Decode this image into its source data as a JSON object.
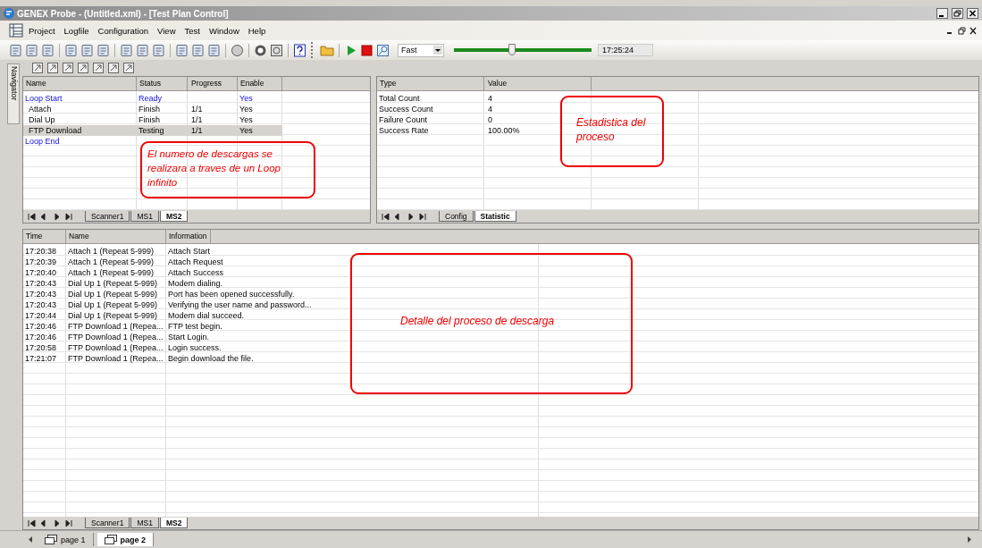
{
  "window": {
    "title": "GENEX Probe - (Untitled.xml) - [Test Plan Control]"
  },
  "menu": [
    "Project",
    "Logfile",
    "Configuration",
    "View",
    "Test",
    "Window",
    "Help"
  ],
  "toolbar": {
    "speed": "Fast",
    "level": 0.42,
    "clock": "17:25:24"
  },
  "navigator": {
    "label": "Navigator"
  },
  "test_plan": {
    "columns": [
      "Name",
      "Status",
      "Progress",
      "Enable"
    ],
    "rows": [
      {
        "kind": "loop",
        "selected": false,
        "cells": [
          "Loop Start",
          "Ready",
          "",
          "Yes"
        ]
      },
      {
        "kind": "step",
        "selected": false,
        "cells": [
          "Attach",
          "Finish",
          "1/1",
          "Yes"
        ]
      },
      {
        "kind": "step",
        "selected": false,
        "cells": [
          "Dial Up",
          "Finish",
          "1/1",
          "Yes"
        ]
      },
      {
        "kind": "step",
        "selected": true,
        "cells": [
          "FTP Download",
          "Testing",
          "1/1",
          "Yes"
        ]
      },
      {
        "kind": "loop",
        "selected": false,
        "cells": [
          "Loop End",
          "",
          "",
          ""
        ]
      }
    ],
    "tabs": [
      {
        "label": "Scanner1",
        "selected": false
      },
      {
        "label": "MS1",
        "selected": false
      },
      {
        "label": "MS2",
        "selected": true
      }
    ],
    "note": "El numero de descargas se realizara a traves de un Loop infinito"
  },
  "statistics": {
    "columns": [
      "Type",
      "Value"
    ],
    "rows": [
      [
        "Total Count",
        "4"
      ],
      [
        "Success Count",
        "4"
      ],
      [
        "Failure Count",
        "0"
      ],
      [
        "Success Rate",
        "100.00%"
      ]
    ],
    "tabs": [
      {
        "label": "Config",
        "selected": false
      },
      {
        "label": "Statistic",
        "selected": true
      }
    ],
    "note": "Estadistica del proceso"
  },
  "log": {
    "columns": [
      "Time",
      "Name",
      "Information"
    ],
    "rows": [
      [
        "17:20:38",
        "Attach 1 (Repeat 5-999)",
        "Attach Start"
      ],
      [
        "17:20:39",
        "Attach 1 (Repeat 5-999)",
        "Attach Request"
      ],
      [
        "17:20:40",
        "Attach 1 (Repeat 5-999)",
        "Attach Success"
      ],
      [
        "17:20:43",
        "Dial Up 1 (Repeat 5-999)",
        "Modem dialing."
      ],
      [
        "17:20:43",
        "Dial Up 1 (Repeat 5-999)",
        "Port has been opened successfully."
      ],
      [
        "17:20:43",
        "Dial Up 1 (Repeat 5-999)",
        "Verifying the user name and password..."
      ],
      [
        "17:20:44",
        "Dial Up 1 (Repeat 5-999)",
        "Modem dial succeed."
      ],
      [
        "17:20:46",
        "FTP Download 1 (Repea...",
        "FTP test begin."
      ],
      [
        "17:20:46",
        "FTP Download 1 (Repea...",
        "Start Login."
      ],
      [
        "17:20:58",
        "FTP Download 1 (Repea...",
        "Login success."
      ],
      [
        "17:21:07",
        "FTP Download 1 (Repea...",
        "Begin download the file."
      ]
    ],
    "tabs": [
      {
        "label": "Scanner1",
        "selected": false
      },
      {
        "label": "MS1",
        "selected": false
      },
      {
        "label": "MS2",
        "selected": true
      }
    ],
    "note": "Detalle del proceso de descarga"
  },
  "pages": [
    {
      "label": "page 1",
      "selected": false
    },
    {
      "label": "page 2",
      "selected": true
    }
  ]
}
